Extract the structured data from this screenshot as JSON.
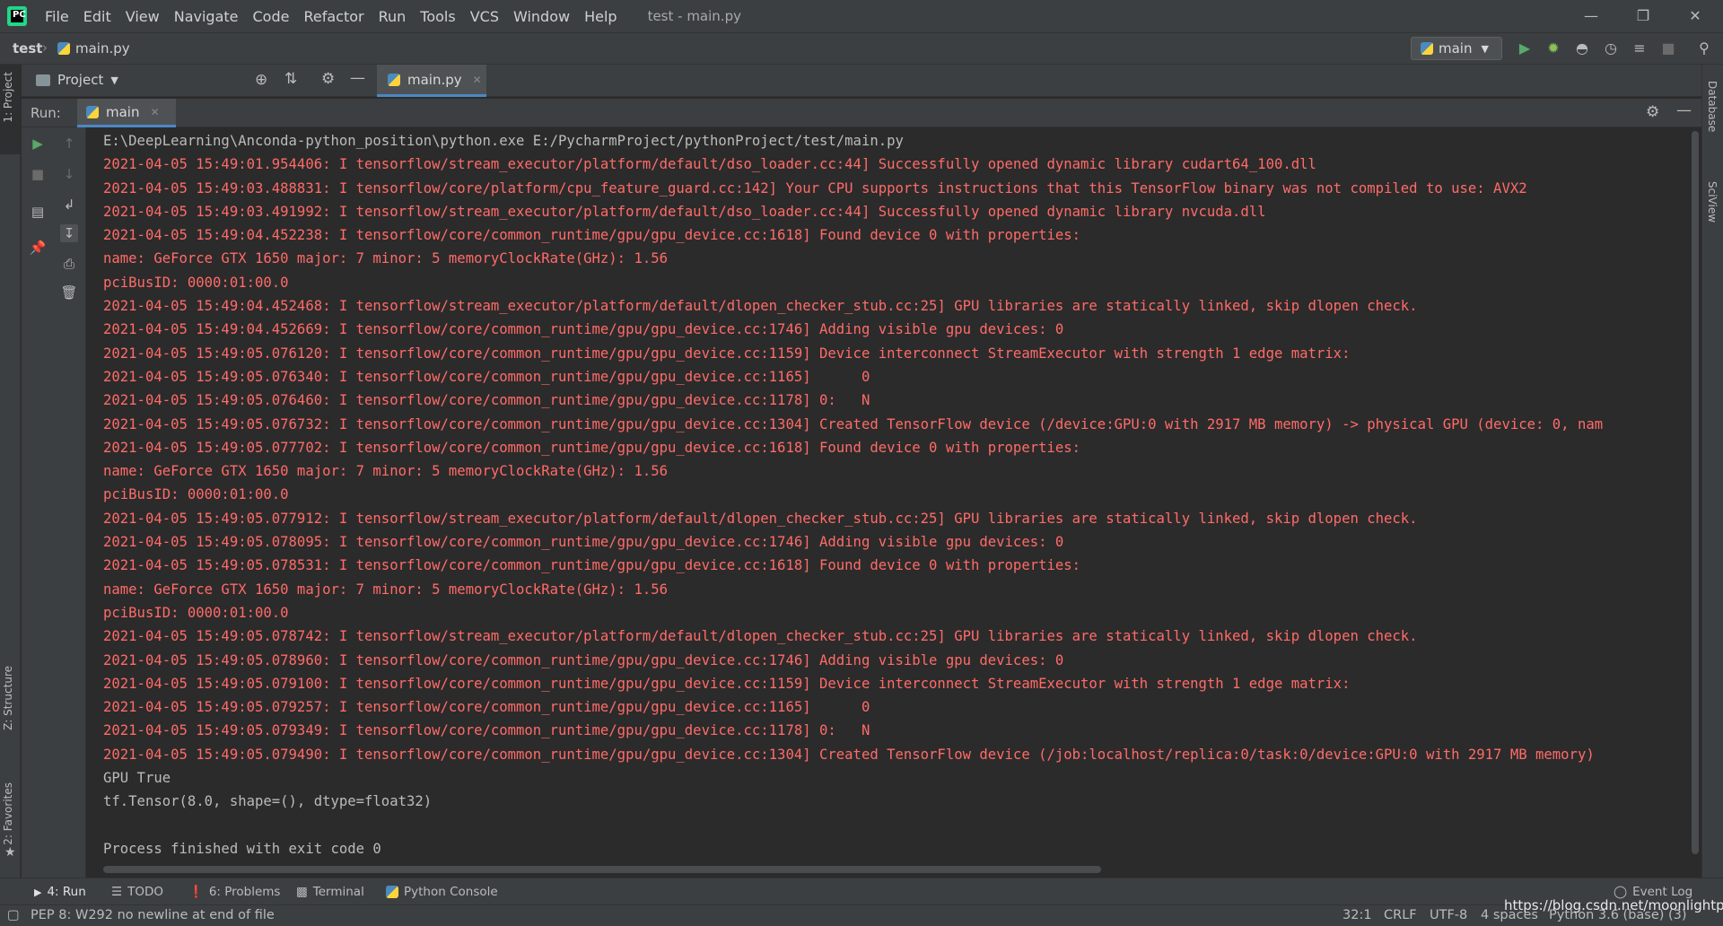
{
  "menubar": {
    "items": [
      "File",
      "Edit",
      "View",
      "Navigate",
      "Code",
      "Refactor",
      "Run",
      "Tools",
      "VCS",
      "Window",
      "Help"
    ],
    "window_title": "test - main.py"
  },
  "navbar": {
    "project": "test",
    "file": "main.py",
    "run_config": "main"
  },
  "left_stripe": {
    "project_tab": "1: Project",
    "structure_tab": "Z: Structure",
    "favorites_tab": "2: Favorites"
  },
  "right_stripe": {
    "database_tab": "Database",
    "sciview_tab": "SciView"
  },
  "project_panel": {
    "title": "Project"
  },
  "editor": {
    "tab_label": "main.py"
  },
  "run_window": {
    "label": "Run:",
    "tab_label": "main"
  },
  "console": {
    "lines": [
      {
        "type": "out",
        "text": "E:\\DeepLearning\\Anconda-python_position\\python.exe E:/PycharmProject/pythonProject/test/main.py"
      },
      {
        "type": "err",
        "text": "2021-04-05 15:49:01.954406: I tensorflow/stream_executor/platform/default/dso_loader.cc:44] Successfully opened dynamic library cudart64_100.dll"
      },
      {
        "type": "err",
        "text": "2021-04-05 15:49:03.488831: I tensorflow/core/platform/cpu_feature_guard.cc:142] Your CPU supports instructions that this TensorFlow binary was not compiled to use: AVX2"
      },
      {
        "type": "err",
        "text": "2021-04-05 15:49:03.491992: I tensorflow/stream_executor/platform/default/dso_loader.cc:44] Successfully opened dynamic library nvcuda.dll"
      },
      {
        "type": "err",
        "text": "2021-04-05 15:49:04.452238: I tensorflow/core/common_runtime/gpu/gpu_device.cc:1618] Found device 0 with properties:"
      },
      {
        "type": "err",
        "text": "name: GeForce GTX 1650 major: 7 minor: 5 memoryClockRate(GHz): 1.56"
      },
      {
        "type": "err",
        "text": "pciBusID: 0000:01:00.0"
      },
      {
        "type": "err",
        "text": "2021-04-05 15:49:04.452468: I tensorflow/stream_executor/platform/default/dlopen_checker_stub.cc:25] GPU libraries are statically linked, skip dlopen check."
      },
      {
        "type": "err",
        "text": "2021-04-05 15:49:04.452669: I tensorflow/core/common_runtime/gpu/gpu_device.cc:1746] Adding visible gpu devices: 0"
      },
      {
        "type": "err",
        "text": "2021-04-05 15:49:05.076120: I tensorflow/core/common_runtime/gpu/gpu_device.cc:1159] Device interconnect StreamExecutor with strength 1 edge matrix:"
      },
      {
        "type": "err",
        "text": "2021-04-05 15:49:05.076340: I tensorflow/core/common_runtime/gpu/gpu_device.cc:1165]      0"
      },
      {
        "type": "err",
        "text": "2021-04-05 15:49:05.076460: I tensorflow/core/common_runtime/gpu/gpu_device.cc:1178] 0:   N"
      },
      {
        "type": "err",
        "text": "2021-04-05 15:49:05.076732: I tensorflow/core/common_runtime/gpu/gpu_device.cc:1304] Created TensorFlow device (/device:GPU:0 with 2917 MB memory) -> physical GPU (device: 0, nam"
      },
      {
        "type": "err",
        "text": "2021-04-05 15:49:05.077702: I tensorflow/core/common_runtime/gpu/gpu_device.cc:1618] Found device 0 with properties:"
      },
      {
        "type": "err",
        "text": "name: GeForce GTX 1650 major: 7 minor: 5 memoryClockRate(GHz): 1.56"
      },
      {
        "type": "err",
        "text": "pciBusID: 0000:01:00.0"
      },
      {
        "type": "err",
        "text": "2021-04-05 15:49:05.077912: I tensorflow/stream_executor/platform/default/dlopen_checker_stub.cc:25] GPU libraries are statically linked, skip dlopen check."
      },
      {
        "type": "err",
        "text": "2021-04-05 15:49:05.078095: I tensorflow/core/common_runtime/gpu/gpu_device.cc:1746] Adding visible gpu devices: 0"
      },
      {
        "type": "err",
        "text": "2021-04-05 15:49:05.078531: I tensorflow/core/common_runtime/gpu/gpu_device.cc:1618] Found device 0 with properties:"
      },
      {
        "type": "err",
        "text": "name: GeForce GTX 1650 major: 7 minor: 5 memoryClockRate(GHz): 1.56"
      },
      {
        "type": "err",
        "text": "pciBusID: 0000:01:00.0"
      },
      {
        "type": "err",
        "text": "2021-04-05 15:49:05.078742: I tensorflow/stream_executor/platform/default/dlopen_checker_stub.cc:25] GPU libraries are statically linked, skip dlopen check."
      },
      {
        "type": "err",
        "text": "2021-04-05 15:49:05.078960: I tensorflow/core/common_runtime/gpu/gpu_device.cc:1746] Adding visible gpu devices: 0"
      },
      {
        "type": "err",
        "text": "2021-04-05 15:49:05.079100: I tensorflow/core/common_runtime/gpu/gpu_device.cc:1159] Device interconnect StreamExecutor with strength 1 edge matrix:"
      },
      {
        "type": "err",
        "text": "2021-04-05 15:49:05.079257: I tensorflow/core/common_runtime/gpu/gpu_device.cc:1165]      0"
      },
      {
        "type": "err",
        "text": "2021-04-05 15:49:05.079349: I tensorflow/core/common_runtime/gpu/gpu_device.cc:1178] 0:   N"
      },
      {
        "type": "err",
        "text": "2021-04-05 15:49:05.079490: I tensorflow/core/common_runtime/gpu/gpu_device.cc:1304] Created TensorFlow device (/job:localhost/replica:0/task:0/device:GPU:0 with 2917 MB memory)"
      },
      {
        "type": "out",
        "text": "GPU True"
      },
      {
        "type": "out",
        "text": "tf.Tensor(8.0, shape=(), dtype=float32)"
      },
      {
        "type": "out",
        "text": ""
      },
      {
        "type": "out",
        "text": "Process finished with exit code 0"
      }
    ]
  },
  "bottom_tabs": {
    "run": "4: Run",
    "todo": "TODO",
    "problems": "6: Problems",
    "terminal": "Terminal",
    "python_console": "Python Console",
    "event_log": "Event Log"
  },
  "statusbar": {
    "message": "PEP 8: W292 no newline at end of file",
    "position": "32:1",
    "line_sep": "CRLF",
    "encoding": "UTF-8",
    "indent": "4 spaces",
    "interpreter": "Python 3.6 (base) (3)"
  },
  "watermark": "https://blog.csdn.net/moonlightpo",
  "colors": {
    "accent": "#4a88c7",
    "stderr": "#ff6b68",
    "run_green": "#59a869",
    "debug_green": "#8dbf5a"
  }
}
